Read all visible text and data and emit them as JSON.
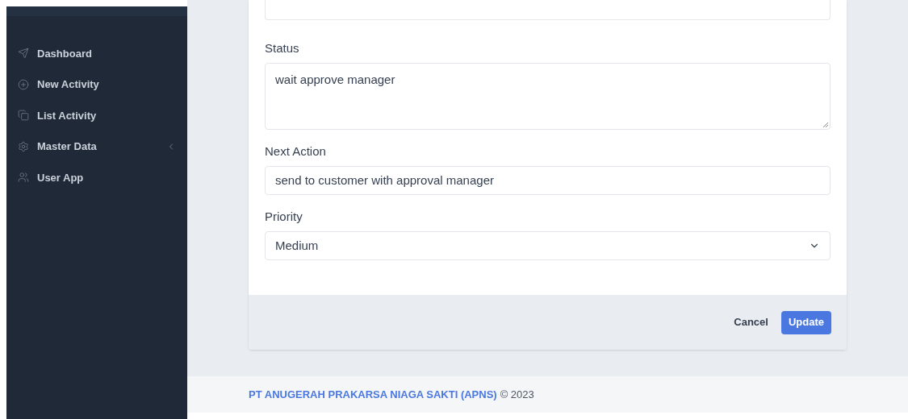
{
  "sidebar": {
    "items": [
      {
        "label": "Dashboard",
        "expandable": false
      },
      {
        "label": "New Activity",
        "expandable": false
      },
      {
        "label": "List Activity",
        "expandable": false
      },
      {
        "label": "Master Data",
        "expandable": true
      },
      {
        "label": "User App",
        "expandable": false
      }
    ]
  },
  "form": {
    "fields": [
      {
        "kind": "textarea",
        "label": "Status",
        "value": "wait approve manager"
      },
      {
        "kind": "input",
        "label": "Next Action",
        "value": "send to customer with approval manager"
      },
      {
        "kind": "select",
        "label": "Priority",
        "value": "Medium"
      }
    ],
    "buttons": [
      {
        "label": "Cancel",
        "kind": "secondary"
      },
      {
        "label": "Update",
        "kind": "primary"
      }
    ]
  },
  "footer": {
    "company": "PT ANUGERAH PRAKARSA NIAGA SAKTI (APNS)",
    "year": "© 2023"
  }
}
